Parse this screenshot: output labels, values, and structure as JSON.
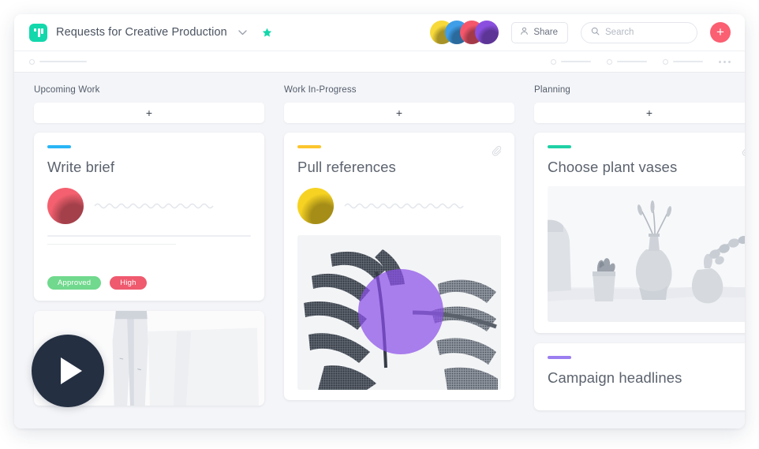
{
  "app": {
    "logo_name": "board-logo",
    "board_title": "Requests for Creative Production",
    "dropdown_icon": "chevron-down-icon",
    "favorite_icon": "star-icon"
  },
  "topbar": {
    "avatars": [
      {
        "name": "avatar-1",
        "color": "#f7d93a"
      },
      {
        "name": "avatar-2",
        "color": "#3f9ee8"
      },
      {
        "name": "avatar-3",
        "color": "#f4576b"
      },
      {
        "name": "avatar-4",
        "color": "#8b4fe0"
      }
    ],
    "share_label": "Share",
    "share_icon": "person-icon",
    "search_placeholder": "Search",
    "search_value": "",
    "search_icon": "search-icon",
    "add_label": "+",
    "add_icon": "plus-icon",
    "add_color": "#fb5f72"
  },
  "subbar": {
    "more_icon": "more-horizontal-icon"
  },
  "columns": [
    {
      "name": "upcoming-work",
      "title": "Upcoming Work",
      "add_label": "+",
      "cards": [
        {
          "name": "write-brief",
          "title": "Write brief",
          "accent": "#29b6f6",
          "assignee_color": "#f4606f",
          "has_clip": false,
          "tags": [
            {
              "label": "Approved",
              "color": "#70d98d"
            },
            {
              "label": "High",
              "color": "#ef5a6e"
            }
          ]
        },
        {
          "name": "jeans-media-card",
          "title": "",
          "accent": "",
          "has_clip": false
        }
      ]
    },
    {
      "name": "work-in-progress",
      "title": "Work In-Progress",
      "add_label": "+",
      "cards": [
        {
          "name": "pull-references",
          "title": "Pull  references",
          "accent": "#fbc52d",
          "assignee_color": "#f6d222",
          "has_clip": true,
          "media": "monstera-leaves-photo",
          "media_overlay_color": "#8b4fe8"
        }
      ]
    },
    {
      "name": "planning",
      "title": "Planning",
      "add_label": "+",
      "cards": [
        {
          "name": "choose-plant-vases",
          "title": "Choose plant vases",
          "accent": "#1fd1a5",
          "has_clip": true,
          "media": "ceramic-vases-photo"
        },
        {
          "name": "campaign-headlines",
          "title": "Campaign headlines",
          "accent": "#9b7ef0",
          "has_clip": false
        }
      ]
    }
  ],
  "overlay": {
    "play_icon": "play-icon",
    "play_color": "#242f42"
  }
}
